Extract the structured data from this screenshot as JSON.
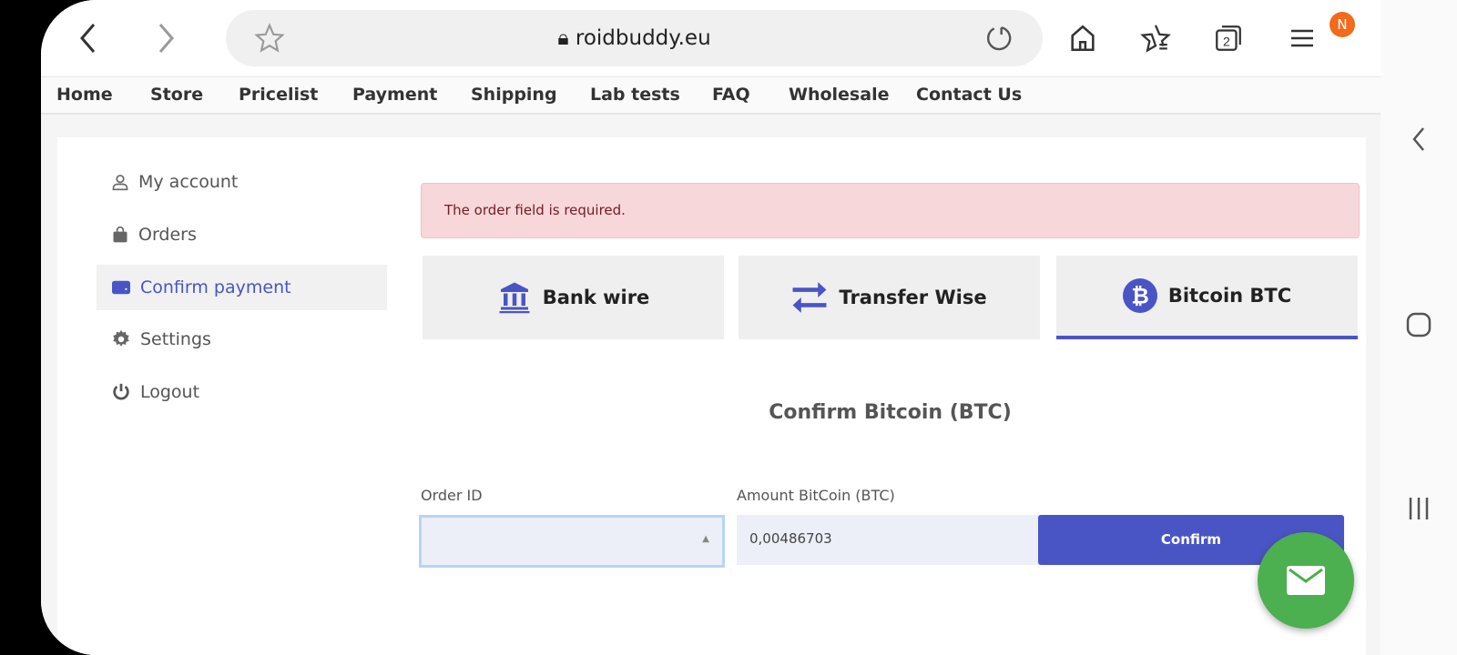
{
  "browser": {
    "url": "roidbuddy.eu",
    "tab_count": "2",
    "menu_badge": "N"
  },
  "nav": [
    "Home",
    "Store",
    "Pricelist",
    "Payment",
    "Shipping",
    "Lab tests",
    "FAQ",
    "Wholesale",
    "Contact Us"
  ],
  "sidebar": {
    "items": [
      {
        "label": "My account",
        "icon": "user-icon"
      },
      {
        "label": "Orders",
        "icon": "shopping-bag-icon"
      },
      {
        "label": "Confirm payment",
        "icon": "wallet-icon",
        "active": true
      },
      {
        "label": "Settings",
        "icon": "gear-icon"
      },
      {
        "label": "Logout",
        "icon": "power-icon"
      }
    ]
  },
  "alert": "The order field is required.",
  "tabs": [
    {
      "label": "Bank wire",
      "icon": "bank-icon"
    },
    {
      "label": "Transfer Wise",
      "icon": "transfer-arrows-icon"
    },
    {
      "label": "Bitcoin BTC",
      "icon": "bitcoin-icon",
      "active": true
    }
  ],
  "form": {
    "heading": "Confirm Bitcoin (BTC)",
    "order_label": "Order ID",
    "order_value": "",
    "amount_label": "Amount BitCoin (BTC)",
    "amount_value": "0,00486703",
    "confirm_label": "Confirm"
  },
  "colors": {
    "accent": "#4a55c5",
    "alert_bg": "#f8d7da",
    "fab": "#4caf50"
  }
}
